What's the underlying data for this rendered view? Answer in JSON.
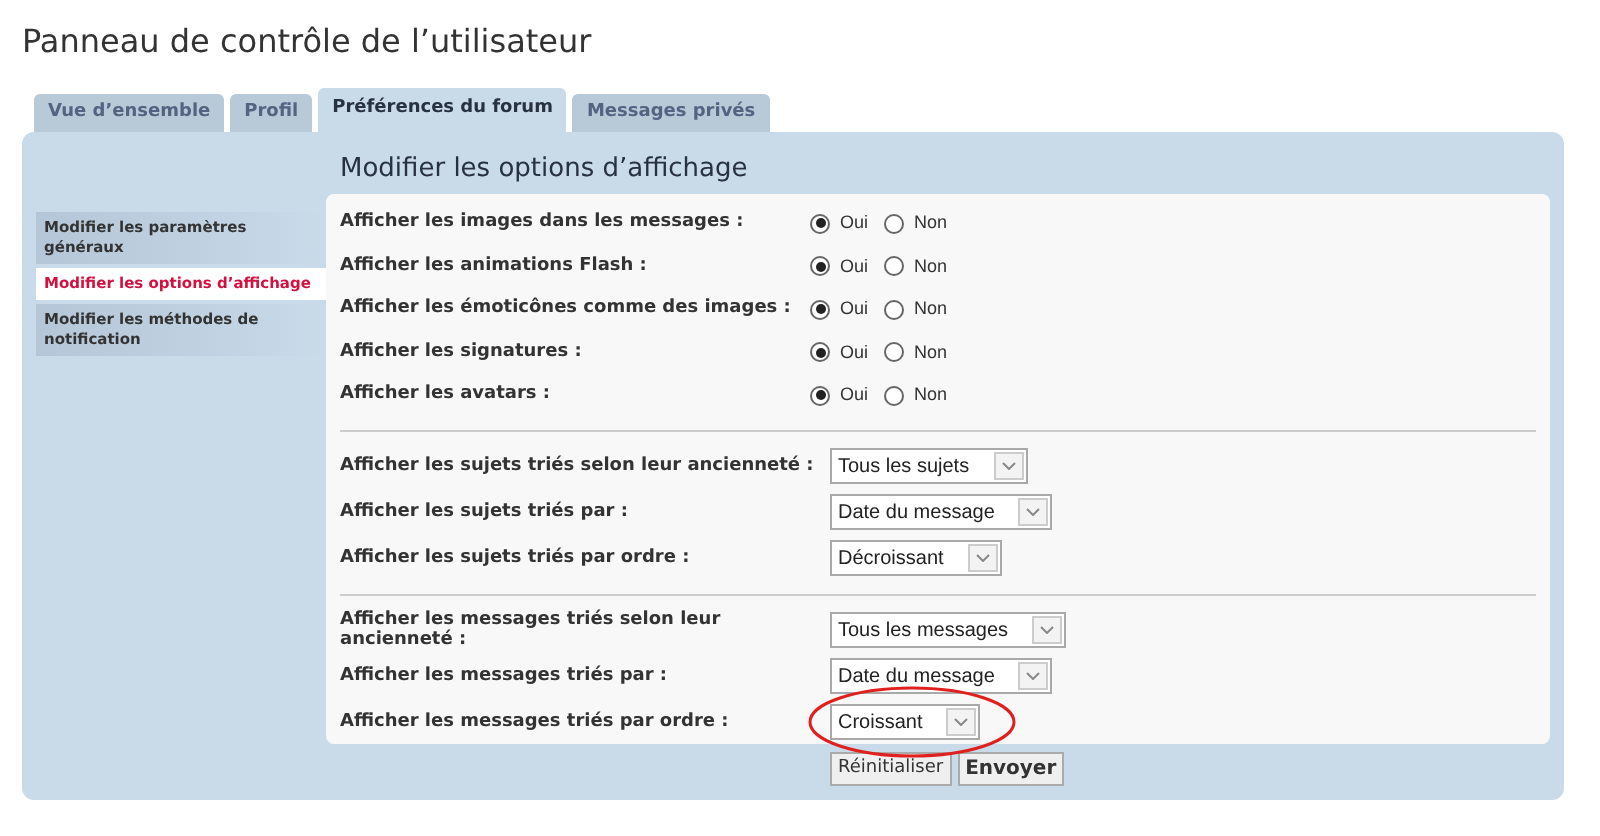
{
  "page_title": "Panneau de contrôle de l’utilisateur",
  "tabs": [
    {
      "label": "Vue d’ensemble",
      "selected": false
    },
    {
      "label": "Profil",
      "selected": false
    },
    {
      "label": "Préférences du forum",
      "selected": true
    },
    {
      "label": "Messages privés",
      "selected": false
    }
  ],
  "sidebar": {
    "items": [
      {
        "label": "Modifier les paramètres généraux",
        "selected": false
      },
      {
        "label": "Modifier les options d’affichage",
        "selected": true
      },
      {
        "label": "Modifier les méthodes de notification",
        "selected": false
      }
    ]
  },
  "heading": "Modifier les options d’affichage",
  "radio_rows": [
    {
      "label": "Afficher les images dans les messages :",
      "options": [
        {
          "label": "Oui",
          "selected": true
        },
        {
          "label": "Non",
          "selected": false
        }
      ]
    },
    {
      "label": "Afficher les animations Flash :",
      "options": [
        {
          "label": "Oui",
          "selected": true
        },
        {
          "label": "Non",
          "selected": false
        }
      ]
    },
    {
      "label": "Afficher les émoticônes comme des images :",
      "options": [
        {
          "label": "Oui",
          "selected": true
        },
        {
          "label": "Non",
          "selected": false
        }
      ]
    },
    {
      "label": "Afficher les signatures :",
      "options": [
        {
          "label": "Oui",
          "selected": true
        },
        {
          "label": "Non",
          "selected": false
        }
      ]
    },
    {
      "label": "Afficher les avatars :",
      "options": [
        {
          "label": "Oui",
          "selected": true
        },
        {
          "label": "Non",
          "selected": false
        }
      ]
    }
  ],
  "select_sections": [
    [
      {
        "label": "Afficher les sujets triés selon leur ancienneté :",
        "value": "Tous les sujets",
        "highlighted": false
      },
      {
        "label": "Afficher les sujets triés par :",
        "value": "Date du message",
        "highlighted": false
      },
      {
        "label": "Afficher les sujets triés par ordre :",
        "value": "Décroissant",
        "highlighted": false
      }
    ],
    [
      {
        "label": "Afficher les messages triés selon leur ancienneté :",
        "value": "Tous les messages",
        "highlighted": false
      },
      {
        "label": "Afficher les messages triés par :",
        "value": "Date du message",
        "highlighted": false
      },
      {
        "label": "Afficher les messages triés par ordre :",
        "value": "Croissant",
        "highlighted": true
      }
    ]
  ],
  "buttons": [
    {
      "label": "Réinitialiser",
      "primary": false
    },
    {
      "label": "Envoyer",
      "primary": true
    }
  ]
}
